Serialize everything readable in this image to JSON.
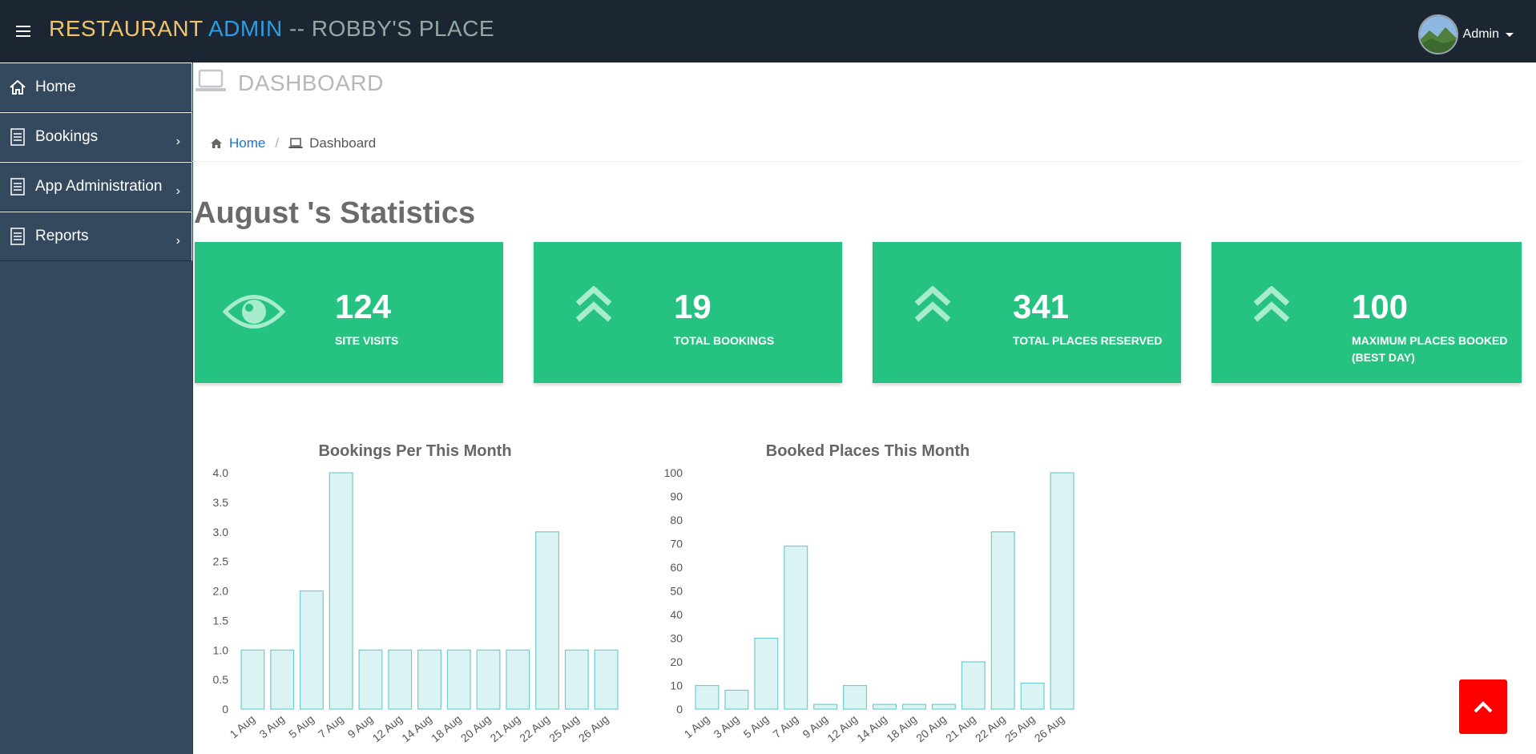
{
  "header": {
    "brand_part1": "RESTAURANT",
    "brand_part2": "ADMIN",
    "brand_part3": "-- ROBBY'S PLACE",
    "user_name": "Admin"
  },
  "sidebar": {
    "items": [
      {
        "label": "Home",
        "icon": "home-icon"
      },
      {
        "label": "Bookings",
        "icon": "list-icon"
      },
      {
        "label": "App Administration",
        "icon": "list-icon"
      },
      {
        "label": "Reports",
        "icon": "list-icon"
      }
    ]
  },
  "page": {
    "title": "DASHBOARD",
    "breadcrumb": {
      "home": "Home",
      "current": "Dashboard"
    },
    "stats_title": "August 's Statistics"
  },
  "cards": [
    {
      "value": "124",
      "label": "SITE VISITS",
      "icon": "eye-icon"
    },
    {
      "value": "19",
      "label": "TOTAL BOOKINGS",
      "icon": "double-chevron-up-icon"
    },
    {
      "value": "341",
      "label": "TOTAL PLACES RESERVED",
      "icon": "double-chevron-up-icon"
    },
    {
      "value": "100",
      "label": "MAXIMUM PLACES BOOKED (BEST DAY)",
      "icon": "double-chevron-up-icon"
    }
  ],
  "colors": {
    "topbar": "#1c2633",
    "sidebar": "#34495e",
    "card": "#26c281",
    "bar_fill": "#dcf3f4",
    "bar_stroke": "#6dcdcf",
    "scroll_button": "#ff0000"
  },
  "chart_data": [
    {
      "type": "bar",
      "title": "Bookings Per This Month",
      "categories": [
        "1 Aug",
        "3 Aug",
        "5 Aug",
        "7 Aug",
        "9 Aug",
        "12 Aug",
        "14 Aug",
        "18 Aug",
        "20 Aug",
        "21 Aug",
        "22 Aug",
        "25 Aug",
        "26 Aug"
      ],
      "values": [
        1,
        1,
        2,
        4,
        1,
        1,
        1,
        1,
        1,
        1,
        3,
        1,
        1
      ],
      "ylim": [
        0,
        4
      ],
      "yticks": [
        "0",
        "0.5",
        "1.0",
        "1.5",
        "2.0",
        "2.5",
        "3.0",
        "3.5",
        "4.0"
      ],
      "ytick_values": [
        0,
        0.5,
        1,
        1.5,
        2,
        2.5,
        3,
        3.5,
        4
      ]
    },
    {
      "type": "bar",
      "title": "Booked Places This Month",
      "categories": [
        "1 Aug",
        "3 Aug",
        "5 Aug",
        "7 Aug",
        "9 Aug",
        "12 Aug",
        "14 Aug",
        "18 Aug",
        "20 Aug",
        "21 Aug",
        "22 Aug",
        "25 Aug",
        "26 Aug"
      ],
      "values": [
        10,
        8,
        30,
        69,
        2,
        10,
        2,
        2,
        2,
        20,
        75,
        11,
        100
      ],
      "ylim": [
        0,
        100
      ],
      "yticks": [
        "0",
        "10",
        "20",
        "30",
        "40",
        "50",
        "60",
        "70",
        "80",
        "90",
        "100"
      ],
      "ytick_values": [
        0,
        10,
        20,
        30,
        40,
        50,
        60,
        70,
        80,
        90,
        100
      ]
    }
  ]
}
